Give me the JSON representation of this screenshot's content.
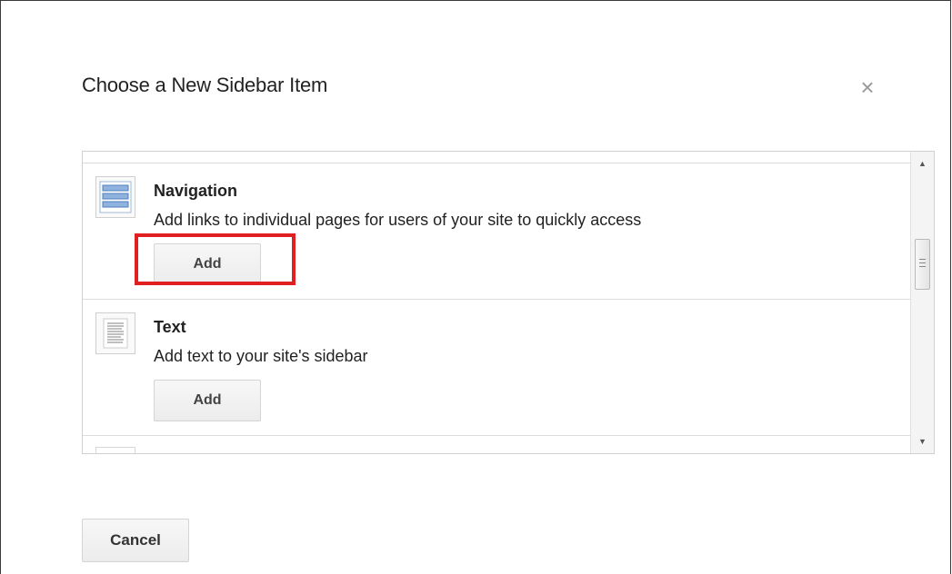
{
  "dialog": {
    "title": "Choose a New Sidebar Item",
    "close_label": "×"
  },
  "items": [
    {
      "title": "Navigation",
      "description": "Add links to individual pages for users of your site to quickly access",
      "button_label": "Add",
      "icon": "navigation-list-icon",
      "highlighted": true
    },
    {
      "title": "Text",
      "description": "Add text to your site's sidebar",
      "button_label": "Add",
      "icon": "text-document-icon",
      "highlighted": false
    }
  ],
  "scrollbar": {
    "up_arrow": "▲",
    "down_arrow": "▼"
  },
  "footer": {
    "cancel_label": "Cancel"
  },
  "colors": {
    "highlight": "#e02020",
    "button_bg": "#f0f0f0",
    "divider": "#dcdcdc"
  }
}
